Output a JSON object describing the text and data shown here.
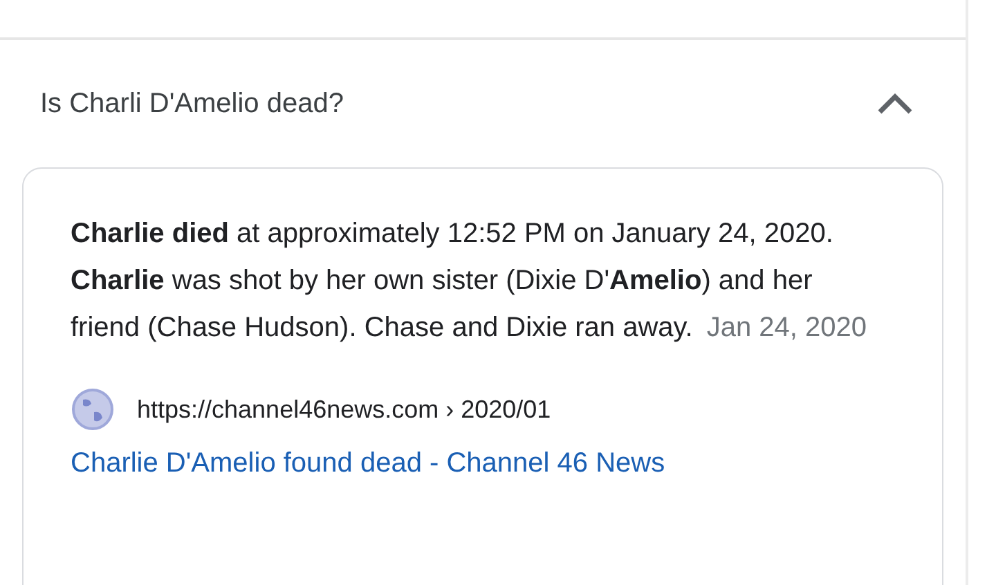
{
  "question": {
    "text": "Is Charli D'Amelio dead?",
    "expanded": true
  },
  "answer": {
    "snippet": "**Charlie died** at approximately 12:52 PM on January 24, 2020. **Charlie** was shot by her own sister (Dixie D'**Amelio**) and her friend (Chase Hudson). Chase and Dixie ran away.",
    "date": "Jan 24, 2020",
    "source_url": "https://channel46news.com › 2020/01",
    "link_title": "Charlie D'Amelio found dead - Channel 46 News"
  }
}
